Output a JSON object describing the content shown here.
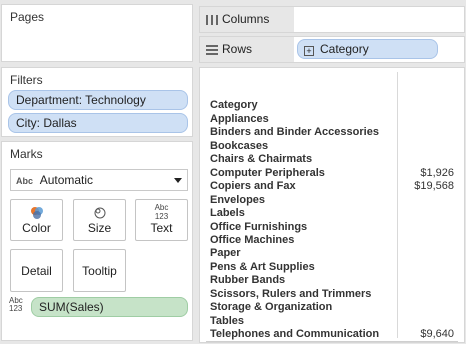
{
  "pages": {
    "title": "Pages"
  },
  "filters": {
    "title": "Filters",
    "items": [
      "Department: Technology",
      "City: Dallas"
    ]
  },
  "marks": {
    "title": "Marks",
    "type_badge": "Abc",
    "mark_type": "Automatic",
    "buttons": {
      "color": "Color",
      "size": "Size",
      "text": "Text",
      "text_icon_top": "Abc",
      "text_icon_bottom": "123",
      "detail": "Detail",
      "tooltip": "Tooltip"
    },
    "field_badge_top": "Abc",
    "field_badge_bottom": "123",
    "field": "SUM(Sales)"
  },
  "columns_shelf": {
    "label": "Columns"
  },
  "rows_shelf": {
    "label": "Rows",
    "pill": "Category",
    "pill_expand": "+"
  },
  "view": {
    "header": "Category",
    "rows": [
      {
        "category": "Appliances",
        "value": ""
      },
      {
        "category": "Binders and Binder Accessories",
        "value": ""
      },
      {
        "category": "Bookcases",
        "value": ""
      },
      {
        "category": "Chairs & Chairmats",
        "value": ""
      },
      {
        "category": "Computer Peripherals",
        "value": "$1,926"
      },
      {
        "category": "Copiers and Fax",
        "value": "$19,568"
      },
      {
        "category": "Envelopes",
        "value": ""
      },
      {
        "category": "Labels",
        "value": ""
      },
      {
        "category": "Office Furnishings",
        "value": ""
      },
      {
        "category": "Office Machines",
        "value": ""
      },
      {
        "category": "Paper",
        "value": ""
      },
      {
        "category": "Pens & Art Supplies",
        "value": ""
      },
      {
        "category": "Rubber Bands",
        "value": ""
      },
      {
        "category": "Scissors, Rulers and Trimmers",
        "value": ""
      },
      {
        "category": "Storage & Organization",
        "value": ""
      },
      {
        "category": "Tables",
        "value": ""
      },
      {
        "category": "Telephones and Communication",
        "value": "$9,640"
      }
    ]
  },
  "colors": {
    "filter_pill": "#cfe0f5",
    "measure_pill": "#c6e3c8",
    "background": "#e7e7e7"
  }
}
